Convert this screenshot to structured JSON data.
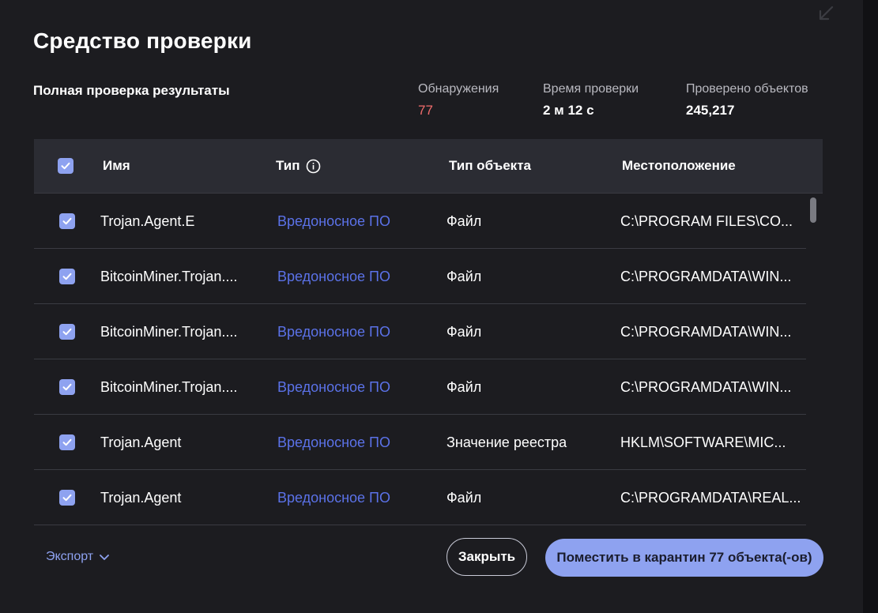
{
  "title": "Средство проверки",
  "subtitle": "Полная проверка результаты",
  "stats": [
    {
      "label": "Обнаружения",
      "value": "77"
    },
    {
      "label": "Время проверки",
      "value": "2 м 12 с"
    },
    {
      "label": "Проверено объектов",
      "value": "245,217"
    }
  ],
  "table": {
    "headers": [
      "Имя",
      "Тип",
      "Тип объекта",
      "Местоположение"
    ],
    "rows": [
      {
        "name": "Trojan.Agent.E",
        "type": "Вредоносное ПО",
        "object_type": "Файл",
        "location": "C:\\PROGRAM FILES\\CO..."
      },
      {
        "name": "BitcoinMiner.Trojan....",
        "type": "Вредоносное ПО",
        "object_type": "Файл",
        "location": "C:\\PROGRAMDATA\\WIN..."
      },
      {
        "name": "BitcoinMiner.Trojan....",
        "type": "Вредоносное ПО",
        "object_type": "Файл",
        "location": "C:\\PROGRAMDATA\\WIN..."
      },
      {
        "name": "BitcoinMiner.Trojan....",
        "type": "Вредоносное ПО",
        "object_type": "Файл",
        "location": "C:\\PROGRAMDATA\\WIN..."
      },
      {
        "name": "Trojan.Agent",
        "type": "Вредоносное ПО",
        "object_type": "Значение реестра",
        "location": "HKLM\\SOFTWARE\\MIC..."
      },
      {
        "name": "Trojan.Agent",
        "type": "Вредоносное ПО",
        "object_type": "Файл",
        "location": "C:\\PROGRAMDATA\\REAL..."
      }
    ]
  },
  "footer": {
    "export_label": "Экспорт",
    "close_label": "Закрыть",
    "quarantine_label": "Поместить в карантин 77 объекта(-ов)"
  },
  "icons": {
    "collapse": "collapse-arrow-icon",
    "info": "info-icon",
    "check": "checkbox-checked-icon",
    "chevron": "chevron-down-icon"
  },
  "colors": {
    "accent": "#8ea2f0",
    "link": "#5b72e8",
    "detections": "#f06b6b",
    "background": "#1c1c20"
  }
}
